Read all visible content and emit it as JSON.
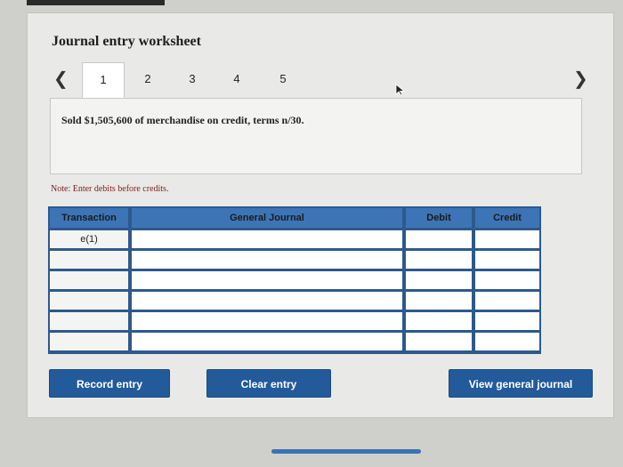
{
  "worksheet": {
    "title": "Journal entry worksheet",
    "tabs": [
      {
        "label": "1",
        "active": true
      },
      {
        "label": "2",
        "active": false
      },
      {
        "label": "3",
        "active": false
      },
      {
        "label": "4",
        "active": false
      },
      {
        "label": "5",
        "active": false
      }
    ],
    "prev_icon": "chevron-left-icon",
    "next_icon": "chevron-right-icon",
    "description": "Sold $1,505,600 of merchandise on credit, terms n/30.",
    "note": "Note: Enter debits before credits."
  },
  "table": {
    "headers": {
      "transaction": "Transaction",
      "general_journal": "General Journal",
      "debit": "Debit",
      "credit": "Credit"
    },
    "rows": [
      {
        "transaction": "e(1)",
        "account": "",
        "debit": "",
        "credit": ""
      },
      {
        "transaction": "",
        "account": "",
        "debit": "",
        "credit": ""
      },
      {
        "transaction": "",
        "account": "",
        "debit": "",
        "credit": ""
      },
      {
        "transaction": "",
        "account": "",
        "debit": "",
        "credit": ""
      },
      {
        "transaction": "",
        "account": "",
        "debit": "",
        "credit": ""
      },
      {
        "transaction": "",
        "account": "",
        "debit": "",
        "credit": ""
      }
    ]
  },
  "buttons": {
    "record": "Record entry",
    "clear": "Clear entry",
    "view": "View general journal"
  },
  "colors": {
    "accent": "#235a9a",
    "header": "#3d74b6",
    "grid_line": "#2c5a8c"
  }
}
